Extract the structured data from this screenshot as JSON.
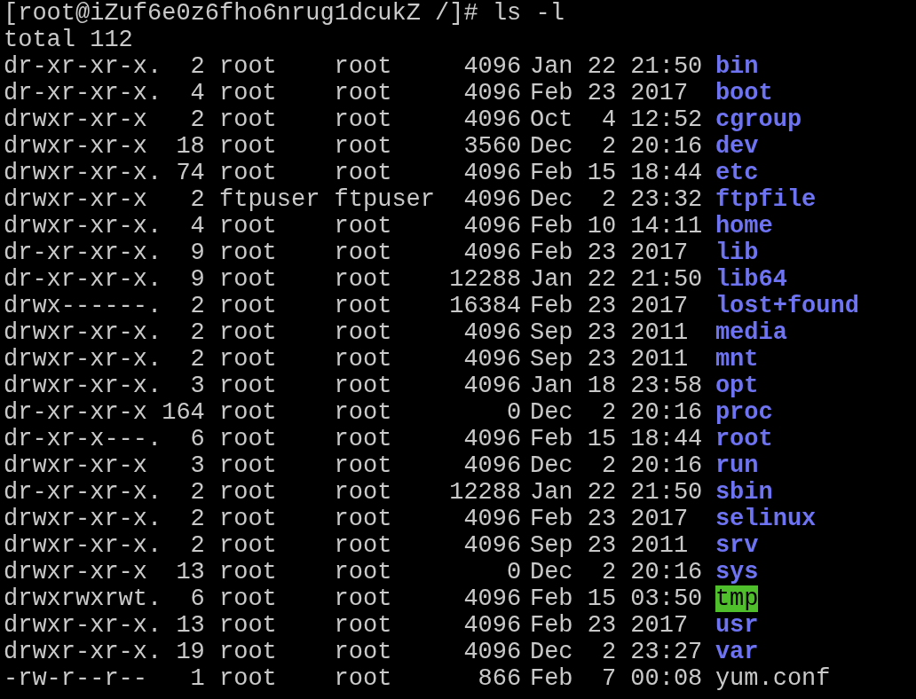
{
  "prompt": "[root@iZuf6e0z6fho6nrug1dcukZ /]#",
  "command": "ls -l",
  "total": "total 112",
  "entries": [
    {
      "perms": "dr-xr-xr-x.",
      "links": "2",
      "owner": "root",
      "group": "root",
      "size": "4096",
      "month": "Jan",
      "day": "22",
      "time": "21:50",
      "name": "bin",
      "kind": "dir"
    },
    {
      "perms": "dr-xr-xr-x.",
      "links": "4",
      "owner": "root",
      "group": "root",
      "size": "4096",
      "month": "Feb",
      "day": "23",
      "time": "2017",
      "name": "boot",
      "kind": "dir"
    },
    {
      "perms": "drwxr-xr-x",
      "links": "2",
      "owner": "root",
      "group": "root",
      "size": "4096",
      "month": "Oct",
      "day": "4",
      "time": "12:52",
      "name": "cgroup",
      "kind": "dir"
    },
    {
      "perms": "drwxr-xr-x",
      "links": "18",
      "owner": "root",
      "group": "root",
      "size": "3560",
      "month": "Dec",
      "day": "2",
      "time": "20:16",
      "name": "dev",
      "kind": "dir"
    },
    {
      "perms": "drwxr-xr-x.",
      "links": "74",
      "owner": "root",
      "group": "root",
      "size": "4096",
      "month": "Feb",
      "day": "15",
      "time": "18:44",
      "name": "etc",
      "kind": "dir"
    },
    {
      "perms": "drwxr-xr-x",
      "links": "2",
      "owner": "ftpuser",
      "group": "ftpuser",
      "size": "4096",
      "month": "Dec",
      "day": "2",
      "time": "23:32",
      "name": "ftpfile",
      "kind": "dir"
    },
    {
      "perms": "drwxr-xr-x.",
      "links": "4",
      "owner": "root",
      "group": "root",
      "size": "4096",
      "month": "Feb",
      "day": "10",
      "time": "14:11",
      "name": "home",
      "kind": "dir"
    },
    {
      "perms": "dr-xr-xr-x.",
      "links": "9",
      "owner": "root",
      "group": "root",
      "size": "4096",
      "month": "Feb",
      "day": "23",
      "time": "2017",
      "name": "lib",
      "kind": "dir"
    },
    {
      "perms": "dr-xr-xr-x.",
      "links": "9",
      "owner": "root",
      "group": "root",
      "size": "12288",
      "month": "Jan",
      "day": "22",
      "time": "21:50",
      "name": "lib64",
      "kind": "dir"
    },
    {
      "perms": "drwx------.",
      "links": "2",
      "owner": "root",
      "group": "root",
      "size": "16384",
      "month": "Feb",
      "day": "23",
      "time": "2017",
      "name": "lost+found",
      "kind": "dir"
    },
    {
      "perms": "drwxr-xr-x.",
      "links": "2",
      "owner": "root",
      "group": "root",
      "size": "4096",
      "month": "Sep",
      "day": "23",
      "time": "2011",
      "name": "media",
      "kind": "dir"
    },
    {
      "perms": "drwxr-xr-x.",
      "links": "2",
      "owner": "root",
      "group": "root",
      "size": "4096",
      "month": "Sep",
      "day": "23",
      "time": "2011",
      "name": "mnt",
      "kind": "dir"
    },
    {
      "perms": "drwxr-xr-x.",
      "links": "3",
      "owner": "root",
      "group": "root",
      "size": "4096",
      "month": "Jan",
      "day": "18",
      "time": "23:58",
      "name": "opt",
      "kind": "dir"
    },
    {
      "perms": "dr-xr-xr-x",
      "links": "164",
      "owner": "root",
      "group": "root",
      "size": "0",
      "month": "Dec",
      "day": "2",
      "time": "20:16",
      "name": "proc",
      "kind": "dir"
    },
    {
      "perms": "dr-xr-x---.",
      "links": "6",
      "owner": "root",
      "group": "root",
      "size": "4096",
      "month": "Feb",
      "day": "15",
      "time": "18:44",
      "name": "root",
      "kind": "dir"
    },
    {
      "perms": "drwxr-xr-x",
      "links": "3",
      "owner": "root",
      "group": "root",
      "size": "4096",
      "month": "Dec",
      "day": "2",
      "time": "20:16",
      "name": "run",
      "kind": "dir"
    },
    {
      "perms": "dr-xr-xr-x.",
      "links": "2",
      "owner": "root",
      "group": "root",
      "size": "12288",
      "month": "Jan",
      "day": "22",
      "time": "21:50",
      "name": "sbin",
      "kind": "dir"
    },
    {
      "perms": "drwxr-xr-x.",
      "links": "2",
      "owner": "root",
      "group": "root",
      "size": "4096",
      "month": "Feb",
      "day": "23",
      "time": "2017",
      "name": "selinux",
      "kind": "dir"
    },
    {
      "perms": "drwxr-xr-x.",
      "links": "2",
      "owner": "root",
      "group": "root",
      "size": "4096",
      "month": "Sep",
      "day": "23",
      "time": "2011",
      "name": "srv",
      "kind": "dir"
    },
    {
      "perms": "drwxr-xr-x",
      "links": "13",
      "owner": "root",
      "group": "root",
      "size": "0",
      "month": "Dec",
      "day": "2",
      "time": "20:16",
      "name": "sys",
      "kind": "dir"
    },
    {
      "perms": "drwxrwxrwt.",
      "links": "6",
      "owner": "root",
      "group": "root",
      "size": "4096",
      "month": "Feb",
      "day": "15",
      "time": "03:50",
      "name": "tmp",
      "kind": "sticky_dir"
    },
    {
      "perms": "drwxr-xr-x.",
      "links": "13",
      "owner": "root",
      "group": "root",
      "size": "4096",
      "month": "Feb",
      "day": "23",
      "time": "2017",
      "name": "usr",
      "kind": "dir"
    },
    {
      "perms": "drwxr-xr-x.",
      "links": "19",
      "owner": "root",
      "group": "root",
      "size": "4096",
      "month": "Dec",
      "day": "2",
      "time": "23:27",
      "name": "var",
      "kind": "dir"
    },
    {
      "perms": "-rw-r--r--",
      "links": "1",
      "owner": "root",
      "group": "root",
      "size": "866",
      "month": "Feb",
      "day": "7",
      "time": "00:08",
      "name": "yum.conf",
      "kind": "file"
    }
  ]
}
